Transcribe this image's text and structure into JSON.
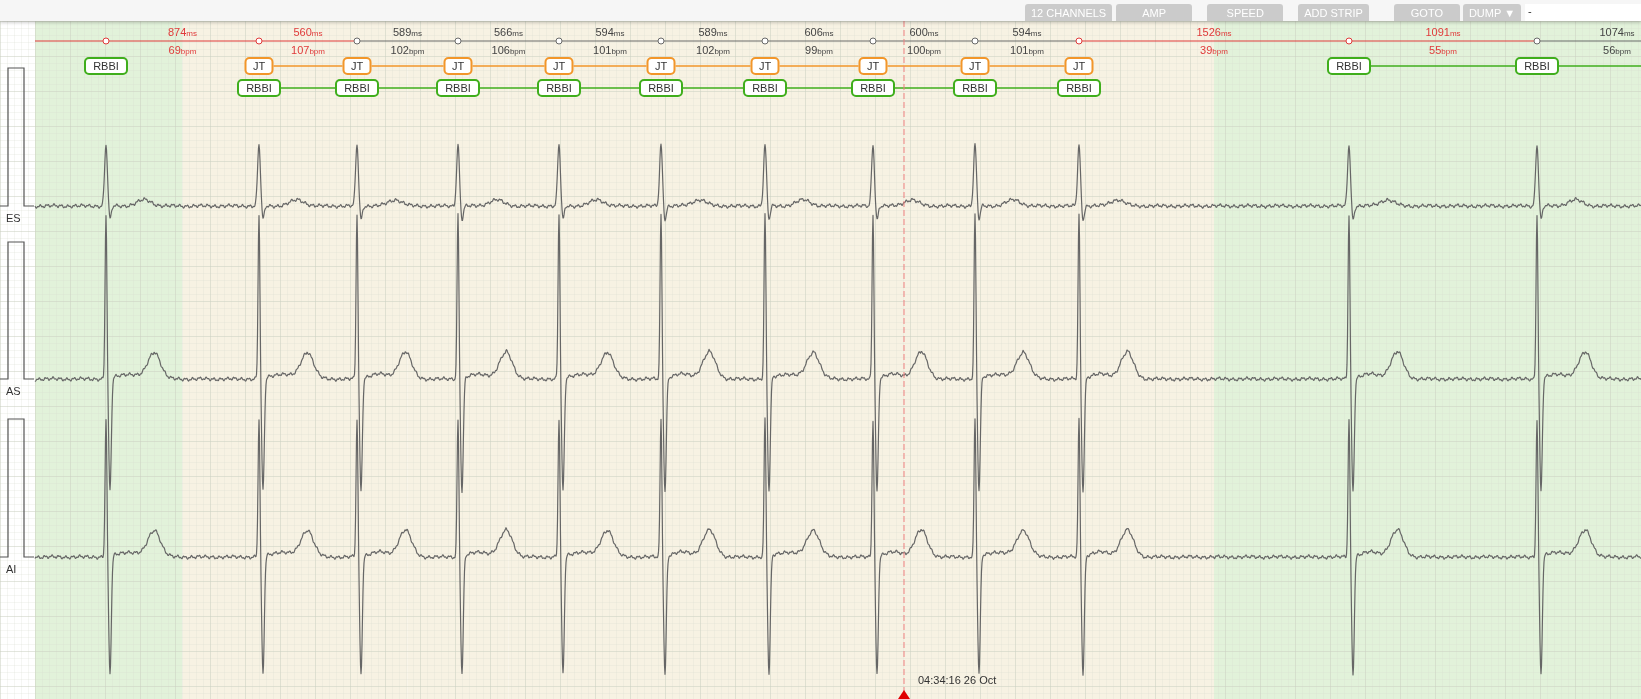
{
  "toolbar": {
    "buttons": [
      "12 CHANNELS",
      "AMP",
      "SPEED",
      "ADD STRIP",
      "GOTO",
      "DUMP ▼"
    ],
    "field_value": "-"
  },
  "leads": [
    "ES",
    "AS",
    "AI"
  ],
  "beats": [
    {
      "color": "#e2f2da",
      "annotations": [
        {
          "text": "RBBI",
          "color": "#3fae1c"
        }
      ],
      "interval": {
        "ms": "874",
        "ms_unit": "ms",
        "bpm": "69",
        "bpm_unit": "bpm",
        "abnormal": true
      }
    },
    {
      "color": "#f7f2e3",
      "annotations": [
        {
          "text": "JT",
          "color": "#f2962a"
        },
        {
          "text": "RBBI",
          "color": "#3fae1c"
        }
      ],
      "interval": {
        "ms": "560",
        "ms_unit": "ms",
        "bpm": "107",
        "bpm_unit": "bpm",
        "abnormal": true
      }
    },
    {
      "color": "#f7f2e3",
      "annotations": [
        {
          "text": "JT",
          "color": "#f2962a"
        },
        {
          "text": "RBBI",
          "color": "#3fae1c"
        }
      ],
      "interval": {
        "ms": "589",
        "ms_unit": "ms",
        "bpm": "102",
        "bpm_unit": "bpm",
        "abnormal": false
      }
    },
    {
      "color": "#f7f2e3",
      "annotations": [
        {
          "text": "JT",
          "color": "#f2962a"
        },
        {
          "text": "RBBI",
          "color": "#3fae1c"
        }
      ],
      "interval": {
        "ms": "566",
        "ms_unit": "ms",
        "bpm": "106",
        "bpm_unit": "bpm",
        "abnormal": false
      }
    },
    {
      "color": "#f7f2e3",
      "annotations": [
        {
          "text": "JT",
          "color": "#f2962a"
        },
        {
          "text": "RBBI",
          "color": "#3fae1c"
        }
      ],
      "interval": {
        "ms": "594",
        "ms_unit": "ms",
        "bpm": "101",
        "bpm_unit": "bpm",
        "abnormal": false
      }
    },
    {
      "color": "#f7f2e3",
      "annotations": [
        {
          "text": "JT",
          "color": "#f2962a"
        },
        {
          "text": "RBBI",
          "color": "#3fae1c"
        }
      ],
      "interval": {
        "ms": "589",
        "ms_unit": "ms",
        "bpm": "102",
        "bpm_unit": "bpm",
        "abnormal": false
      }
    },
    {
      "color": "#f7f2e3",
      "annotations": [
        {
          "text": "JT",
          "color": "#f2962a"
        },
        {
          "text": "RBBI",
          "color": "#3fae1c"
        }
      ],
      "interval": {
        "ms": "606",
        "ms_unit": "ms",
        "bpm": "99",
        "bpm_unit": "bpm",
        "abnormal": false
      }
    },
    {
      "color": "#f7f2e3",
      "annotations": [
        {
          "text": "JT",
          "color": "#f2962a"
        },
        {
          "text": "RBBI",
          "color": "#3fae1c"
        }
      ],
      "interval": {
        "ms": "600",
        "ms_unit": "ms",
        "bpm": "100",
        "bpm_unit": "bpm",
        "abnormal": false
      }
    },
    {
      "color": "#f7f2e3",
      "annotations": [
        {
          "text": "JT",
          "color": "#f2962a"
        },
        {
          "text": "RBBI",
          "color": "#3fae1c"
        }
      ],
      "interval": {
        "ms": "594",
        "ms_unit": "ms",
        "bpm": "101",
        "bpm_unit": "bpm",
        "abnormal": false
      }
    },
    {
      "color": "#f7f2e3",
      "annotations": [
        {
          "text": "JT",
          "color": "#f2962a"
        },
        {
          "text": "RBBI",
          "color": "#3fae1c"
        }
      ],
      "interval": {
        "ms": "1526",
        "ms_unit": "ms",
        "bpm": "39",
        "bpm_unit": "bpm",
        "abnormal": true
      }
    },
    {
      "color": "#e2f2da",
      "annotations": [
        {
          "text": "RBBI",
          "color": "#3fae1c"
        }
      ],
      "interval": {
        "ms": "1091",
        "ms_unit": "ms",
        "bpm": "55",
        "bpm_unit": "bpm",
        "abnormal": true
      }
    },
    {
      "color": "#e2f2da",
      "annotations": [
        {
          "text": "RBBI",
          "color": "#3fae1c"
        }
      ],
      "interval": {
        "ms": "1074",
        "ms_unit": "ms",
        "bpm": "56",
        "bpm_unit": "bpm",
        "abnormal": false
      }
    }
  ],
  "cursor": {
    "time": "04:34:16 26 Oct"
  }
}
